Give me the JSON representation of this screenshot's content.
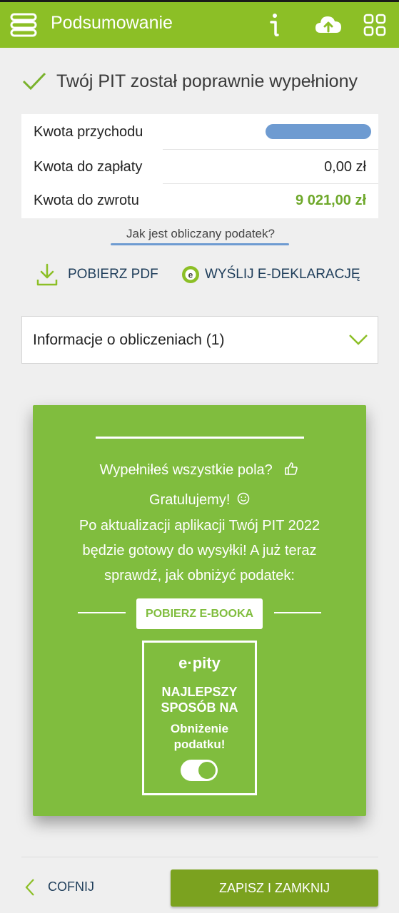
{
  "header": {
    "title": "Podsumowanie",
    "icons": [
      "menu-icon",
      "info-icon",
      "cloud-upload-icon",
      "apps-grid-icon"
    ]
  },
  "status": {
    "message": "Twój PIT został poprawnie wypełniony"
  },
  "summary": {
    "rows": [
      {
        "label": "Kwota przychodu",
        "value": ""
      },
      {
        "label": "Kwota do zapłaty",
        "value": "0,00 zł"
      },
      {
        "label": "Kwota do zwrotu",
        "value": "9 021,00 zł"
      }
    ]
  },
  "how_link": "Jak jest obliczany podatek?",
  "actions": {
    "pdf": "POBIERZ PDF",
    "send": "WYŚLIJ E-DEKLARACJĘ"
  },
  "accordion": {
    "label": "Informacje o obliczeniach (1)"
  },
  "promo": {
    "line1": "Wypełniłeś wszystkie pola?",
    "line2": "Gratulujemy!",
    "line3": "Po aktualizacji aplikacji Twój PIT 2022",
    "line4": "będzie gotowy do wysyłki! A już teraz",
    "line5": "sprawdź, jak obniżyć podatek:",
    "cta": "POBIERZ E-BOOKA",
    "ebook": {
      "logo": "e·pity",
      "title": "NAJLEPSZY SPOSÓB NA",
      "subtitle": "Obniżenie podatku!"
    }
  },
  "footer": {
    "back": "COFNIJ",
    "save": "ZAPISZ I ZAMKNIJ"
  },
  "colors": {
    "brand": "#8cbf26",
    "promo": "#80bd3e",
    "save": "#7ba21f",
    "accent_text": "#1e3d5a",
    "refund": "#6ea82a"
  }
}
